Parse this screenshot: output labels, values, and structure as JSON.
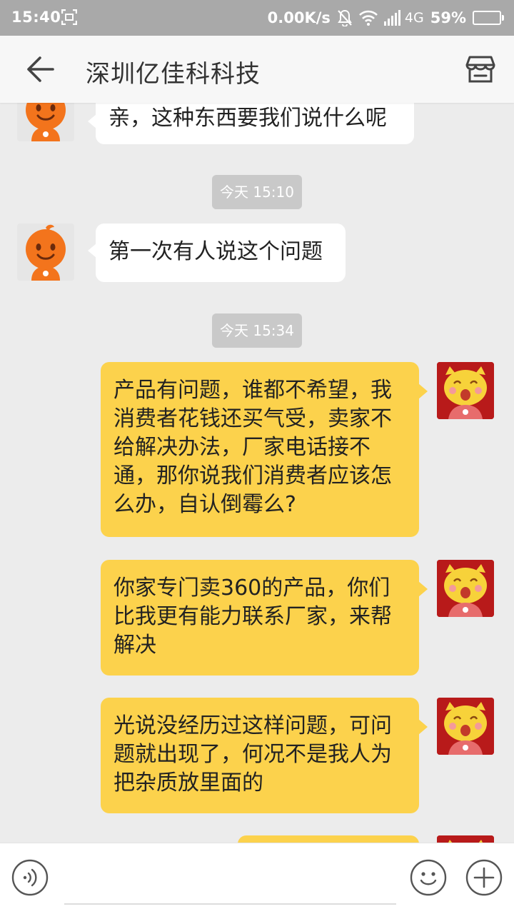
{
  "status_bar": {
    "time": "15:40",
    "net_speed": "0.00K/s",
    "network_type": "4G",
    "battery": "59%",
    "battery_level": 0.59,
    "icons": [
      "screenshot-icon",
      "mute-bell-icon",
      "wifi-icon",
      "signal-icon",
      "battery-icon"
    ]
  },
  "header": {
    "title": "深圳亿佳科科技",
    "icons": [
      "back-arrow-icon",
      "shop-icon"
    ]
  },
  "messages": [
    {
      "side": "left",
      "text": "亲，这种东西要我们说什么呢"
    },
    {
      "type": "timestamp",
      "text": "今天 15:10"
    },
    {
      "side": "left",
      "text": "第一次有人说这个问题"
    },
    {
      "type": "timestamp",
      "text": "今天 15:34"
    },
    {
      "side": "right",
      "lines": [
        "产品有问题，谁都不希望，我",
        "消费者花钱还买气受，卖家不",
        "给解决办法，厂家电话接不",
        "通，那你说我们消费者应该怎",
        "么办，自认倒霉么?"
      ]
    },
    {
      "side": "right",
      "lines": [
        "你家专门卖360的产品，你们",
        "比我更有能力联系厂家，来帮",
        "解决"
      ]
    },
    {
      "side": "right",
      "lines": [
        "光说没经历过这样问题，可问",
        "题就出现了，何况不是我人为",
        "把杂质放里面的"
      ]
    }
  ],
  "input_bar": {
    "placeholder": "",
    "icons": [
      "voice-icon",
      "emoji-icon",
      "plus-icon"
    ]
  },
  "colors": {
    "status_bar_bg": "#a9a9a9",
    "header_bg": "#f7f7f7",
    "chat_bg": "#ececec",
    "left_bubble": "#ffffff",
    "right_bubble": "#fcd24c",
    "timestamp_bg": "#c9c9c9"
  }
}
